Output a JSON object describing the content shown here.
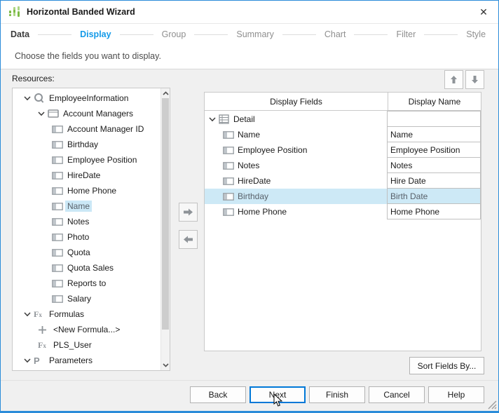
{
  "window": {
    "title": "Horizontal Banded Wizard",
    "app_icon": "banded-chart-icon",
    "close": "✕"
  },
  "steps": [
    {
      "label": "Data",
      "state": "completed"
    },
    {
      "label": "Display",
      "state": "active"
    },
    {
      "label": "Group",
      "state": "upcoming"
    },
    {
      "label": "Summary",
      "state": "upcoming"
    },
    {
      "label": "Chart",
      "state": "upcoming"
    },
    {
      "label": "Filter",
      "state": "upcoming"
    },
    {
      "label": "Style",
      "state": "upcoming"
    }
  ],
  "subtitle": "Choose the fields you want to display.",
  "resources": {
    "label": "Resources:",
    "tree": [
      {
        "label": "EmployeeInformation",
        "icon": "query-icon",
        "level": 0,
        "chevron": true
      },
      {
        "label": "Account Managers",
        "icon": "table-icon",
        "level": 1,
        "chevron": true
      },
      {
        "label": "Account Manager ID",
        "icon": "field-icon",
        "level": 2
      },
      {
        "label": "Birthday",
        "icon": "field-icon",
        "level": 2
      },
      {
        "label": "Employee Position",
        "icon": "field-icon",
        "level": 2
      },
      {
        "label": "HireDate",
        "icon": "field-icon",
        "level": 2
      },
      {
        "label": "Home Phone",
        "icon": "field-icon",
        "level": 2
      },
      {
        "label": "Name",
        "icon": "field-icon",
        "level": 2,
        "selected": true
      },
      {
        "label": "Notes",
        "icon": "field-icon",
        "level": 2
      },
      {
        "label": "Photo",
        "icon": "field-icon",
        "level": 2
      },
      {
        "label": "Quota",
        "icon": "field-icon",
        "level": 2
      },
      {
        "label": "Quota Sales",
        "icon": "field-icon",
        "level": 2
      },
      {
        "label": "Reports to",
        "icon": "field-icon",
        "level": 2
      },
      {
        "label": "Salary",
        "icon": "field-icon",
        "level": 2
      },
      {
        "label": "Formulas",
        "icon": "fx-icon",
        "level": 0,
        "chevron": true
      },
      {
        "label": "<New Formula...>",
        "icon": "plus-icon",
        "level": 1
      },
      {
        "label": "PLS_User",
        "icon": "fx-icon",
        "level": 1
      },
      {
        "label": "Parameters",
        "icon": "parameter-icon",
        "level": 0,
        "chevron": true
      }
    ]
  },
  "fields_table": {
    "headers": [
      "Display Fields",
      "Display Name"
    ],
    "rows": [
      {
        "field": "Detail",
        "display_name": "",
        "type": "group",
        "icon": "detail-band-icon",
        "chevron": true
      },
      {
        "field": "Name",
        "display_name": "Name",
        "type": "field",
        "icon": "field-icon"
      },
      {
        "field": "Employee Position",
        "display_name": "Employee Position",
        "type": "field",
        "icon": "field-icon"
      },
      {
        "field": "Notes",
        "display_name": "Notes",
        "type": "field",
        "icon": "field-icon"
      },
      {
        "field": "HireDate",
        "display_name": "Hire Date",
        "type": "field",
        "icon": "field-icon"
      },
      {
        "field": "Birthday",
        "display_name": "Birth Date",
        "type": "field",
        "icon": "field-icon",
        "selected": true
      },
      {
        "field": "Home Phone",
        "display_name": "Home Phone",
        "type": "field",
        "icon": "field-icon"
      }
    ]
  },
  "move_buttons": {
    "up": "up-arrow-icon",
    "down": "down-arrow-icon",
    "add": "right-arrow-icon",
    "remove": "left-arrow-icon"
  },
  "buttons": {
    "sort": "Sort Fields By...",
    "back": "Back",
    "next": "Next",
    "finish": "Finish",
    "cancel": "Cancel",
    "help": "Help"
  },
  "colors": {
    "accent_blue": "#149AE8",
    "window_border": "#2B8CD9",
    "selection_blue": "#CDE8F6",
    "icon_green": "#7CBA45",
    "icon_green_light": "#ABD584"
  }
}
